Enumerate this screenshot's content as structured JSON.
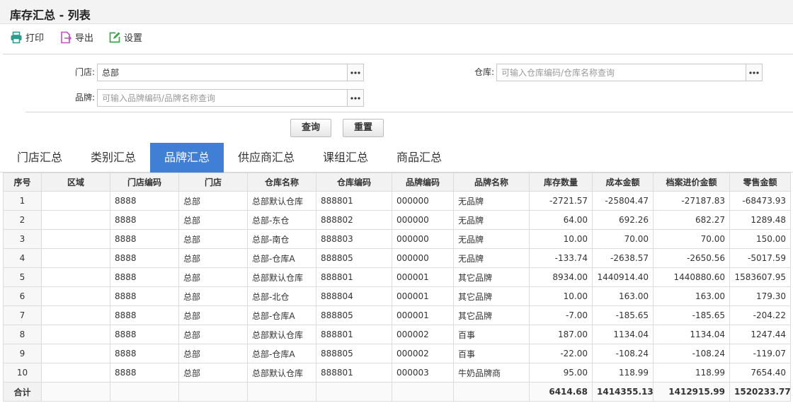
{
  "page_title": "库存汇总 - 列表",
  "toolbar": {
    "print_label": "打印",
    "export_label": "导出",
    "settings_label": "设置"
  },
  "filters": {
    "store_label": "门店:",
    "store_value": "总部",
    "warehouse_label": "仓库:",
    "warehouse_placeholder": "可输入仓库编码/仓库名称查询",
    "brand_label": "品牌:",
    "brand_placeholder": "可输入品牌编码/品牌名称查询"
  },
  "actions": {
    "query_label": "查询",
    "reset_label": "重置"
  },
  "tabs": [
    {
      "label": "门店汇总",
      "active": false
    },
    {
      "label": "类别汇总",
      "active": false
    },
    {
      "label": "品牌汇总",
      "active": true
    },
    {
      "label": "供应商汇总",
      "active": false
    },
    {
      "label": "课组汇总",
      "active": false
    },
    {
      "label": "商品汇总",
      "active": false
    }
  ],
  "table": {
    "columns": [
      "序号",
      "区域",
      "门店编码",
      "门店",
      "仓库名称",
      "仓库编码",
      "品牌编码",
      "品牌名称",
      "库存数量",
      "成本金额",
      "档案进价金额",
      "零售金额"
    ],
    "rows": [
      [
        "1",
        "",
        "8888",
        "总部",
        "总部默认仓库",
        "888801",
        "000000",
        "无品牌",
        "-2721.57",
        "-25804.47",
        "-27187.83",
        "-68473.93"
      ],
      [
        "2",
        "",
        "8888",
        "总部",
        "总部-东仓",
        "888802",
        "000000",
        "无品牌",
        "64.00",
        "692.26",
        "682.27",
        "1289.48"
      ],
      [
        "3",
        "",
        "8888",
        "总部",
        "总部-南仓",
        "888803",
        "000000",
        "无品牌",
        "10.00",
        "70.00",
        "70.00",
        "150.00"
      ],
      [
        "4",
        "",
        "8888",
        "总部",
        "总部-仓库A",
        "888805",
        "000000",
        "无品牌",
        "-133.74",
        "-2638.57",
        "-2650.56",
        "-5017.59"
      ],
      [
        "5",
        "",
        "8888",
        "总部",
        "总部默认仓库",
        "888801",
        "000001",
        "其它品牌",
        "8934.00",
        "1440914.40",
        "1440880.60",
        "1583607.95"
      ],
      [
        "6",
        "",
        "8888",
        "总部",
        "总部-北仓",
        "888804",
        "000001",
        "其它品牌",
        "10.00",
        "163.00",
        "163.00",
        "179.30"
      ],
      [
        "7",
        "",
        "8888",
        "总部",
        "总部-仓库A",
        "888805",
        "000001",
        "其它品牌",
        "-7.00",
        "-185.65",
        "-185.65",
        "-204.22"
      ],
      [
        "8",
        "",
        "8888",
        "总部",
        "总部默认仓库",
        "888801",
        "000002",
        "百事",
        "187.00",
        "1134.04",
        "1134.04",
        "1247.44"
      ],
      [
        "9",
        "",
        "8888",
        "总部",
        "总部-仓库A",
        "888805",
        "000002",
        "百事",
        "-22.00",
        "-108.24",
        "-108.24",
        "-119.07"
      ],
      [
        "10",
        "",
        "8888",
        "总部",
        "总部默认仓库",
        "888801",
        "000003",
        "牛奶品牌商",
        "95.00",
        "118.99",
        "118.99",
        "7654.40"
      ]
    ],
    "total": {
      "label": "合计",
      "qty": "6414.68",
      "cost": "1414355.13",
      "archive_cost": "1412915.99",
      "retail": "1520233.77"
    }
  },
  "icons": {
    "print": "printer-icon",
    "export": "export-file-icon",
    "settings": "edit-settings-icon",
    "more": "more-dots-icon"
  },
  "colors": {
    "accent": "#3f7fd6",
    "print_icon": "#2a9d8f",
    "export_icon": "#c050c0",
    "settings_icon": "#3aa64a"
  }
}
